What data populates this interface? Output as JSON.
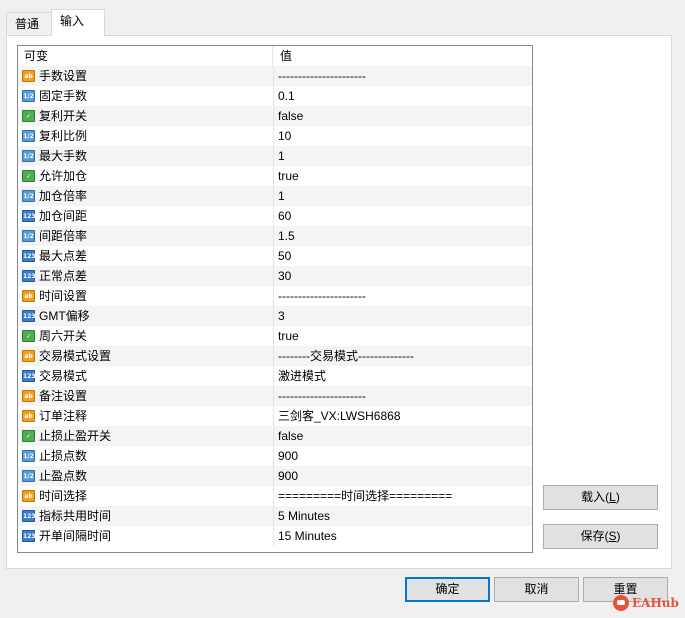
{
  "tabs": [
    {
      "label": "普通",
      "active": false
    },
    {
      "label": "输入",
      "active": true
    }
  ],
  "grid": {
    "headers": {
      "name": "可变",
      "value": "值"
    },
    "rows": [
      {
        "icon": "ab",
        "name": "手数设置",
        "value": "----------------------"
      },
      {
        "icon": "frac",
        "name": "固定手数",
        "value": "0.1"
      },
      {
        "icon": "bool",
        "name": "复利开关",
        "value": "false"
      },
      {
        "icon": "frac",
        "name": "复利比例",
        "value": "10"
      },
      {
        "icon": "frac",
        "name": "最大手数",
        "value": "1"
      },
      {
        "icon": "bool",
        "name": "允许加仓",
        "value": "true"
      },
      {
        "icon": "frac",
        "name": "加仓倍率",
        "value": "1"
      },
      {
        "icon": "int",
        "name": "加仓间距",
        "value": "60"
      },
      {
        "icon": "frac",
        "name": "间距倍率",
        "value": "1.5"
      },
      {
        "icon": "int",
        "name": "最大点差",
        "value": "50"
      },
      {
        "icon": "int",
        "name": "正常点差",
        "value": "30"
      },
      {
        "icon": "ab",
        "name": "时间设置",
        "value": "----------------------"
      },
      {
        "icon": "int",
        "name": "GMT偏移",
        "value": "3"
      },
      {
        "icon": "bool",
        "name": "周六开关",
        "value": "true"
      },
      {
        "icon": "ab",
        "name": "交易模式设置",
        "value": "--------交易模式--------------"
      },
      {
        "icon": "int",
        "name": "交易模式",
        "value": "激进模式"
      },
      {
        "icon": "ab",
        "name": "备注设置",
        "value": "----------------------"
      },
      {
        "icon": "ab",
        "name": "订单注释",
        "value": "三剑客_VX:LWSH6868"
      },
      {
        "icon": "bool",
        "name": "止损止盈开关",
        "value": "false"
      },
      {
        "icon": "frac",
        "name": "止损点数",
        "value": "900"
      },
      {
        "icon": "frac",
        "name": "止盈点数",
        "value": "900"
      },
      {
        "icon": "ab",
        "name": "时间选择",
        "value": "=========时间选择========="
      },
      {
        "icon": "int",
        "name": "指标共用时间",
        "value": "5 Minutes"
      },
      {
        "icon": "int",
        "name": "开单间隔时间",
        "value": "15 Minutes"
      }
    ]
  },
  "icon_labels": {
    "ab": "ab",
    "frac": "1/2",
    "int": "123",
    "bool": "✓"
  },
  "side_buttons": {
    "load": {
      "label": "载入(",
      "mnemonic": "L",
      "suffix": ")"
    },
    "save": {
      "label": "保存(",
      "mnemonic": "S",
      "suffix": ")"
    }
  },
  "footer_buttons": {
    "ok": "确定",
    "cancel": "取消",
    "reset": "重置"
  },
  "watermark": "EAHub",
  "colors": {
    "focus_border": "#0078d7",
    "brand": "#e5533c"
  }
}
